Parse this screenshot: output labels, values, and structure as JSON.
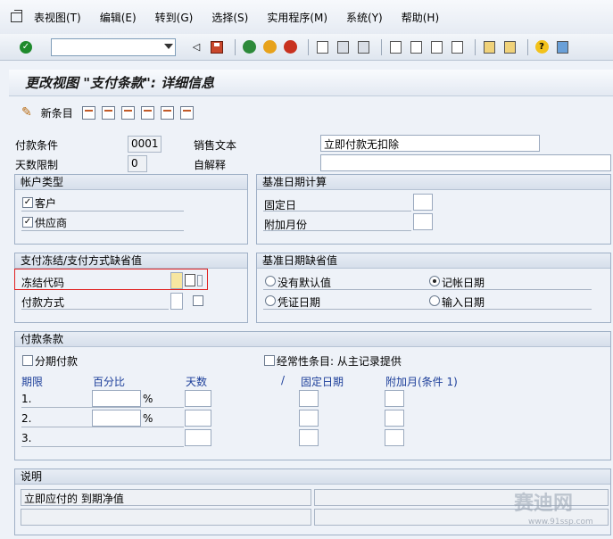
{
  "menu": {
    "items": [
      "表视图(T)",
      "编辑(E)",
      "转到(G)",
      "选择(S)",
      "实用程序(M)",
      "系统(Y)",
      "帮助(H)"
    ]
  },
  "toolbar": {
    "command_value": ""
  },
  "title": "更改视图 \"支付条款\": 详细信息",
  "app_toolbar": {
    "new_entries": "新条目"
  },
  "header_fields": {
    "payment_terms_label": "付款条件",
    "payment_terms_value": "0001",
    "sales_text_label": "销售文本",
    "sales_text_value": "立即付款无扣除",
    "day_limit_label": "天数限制",
    "day_limit_value": "0",
    "explanation_label": "自解释",
    "explanation_value": ""
  },
  "account_type": {
    "title": "帐户类型",
    "customer": "客户",
    "vendor": "供应商"
  },
  "baseline_calc": {
    "title": "基准日期计算",
    "fixed_day": "固定日",
    "add_months": "附加月份"
  },
  "block_group": {
    "title": "支付冻结/支付方式缺省值",
    "block_key": "冻结代码",
    "payment_method": "付款方式"
  },
  "baseline_default": {
    "title": "基准日期缺省值",
    "no_default": "没有默认值",
    "posting_date": "记帐日期",
    "document_date": "凭证日期",
    "entry_date": "输入日期"
  },
  "terms": {
    "title": "付款条款",
    "installment": "分期付款",
    "recurring": "经常性条目: 从主记录提供",
    "col_term": "期限",
    "col_percent": "百分比",
    "col_days": "天数",
    "col_slash": "/",
    "col_fixed": "固定日期",
    "col_addm": "附加月(条件 1)",
    "pct": "%",
    "rows": [
      "1.",
      "2.",
      "3."
    ]
  },
  "explanations": {
    "title": "说明",
    "line1": "立即应付的 到期净值"
  },
  "watermark": {
    "text": "赛迪网",
    "url": "www.91ssp.com"
  }
}
